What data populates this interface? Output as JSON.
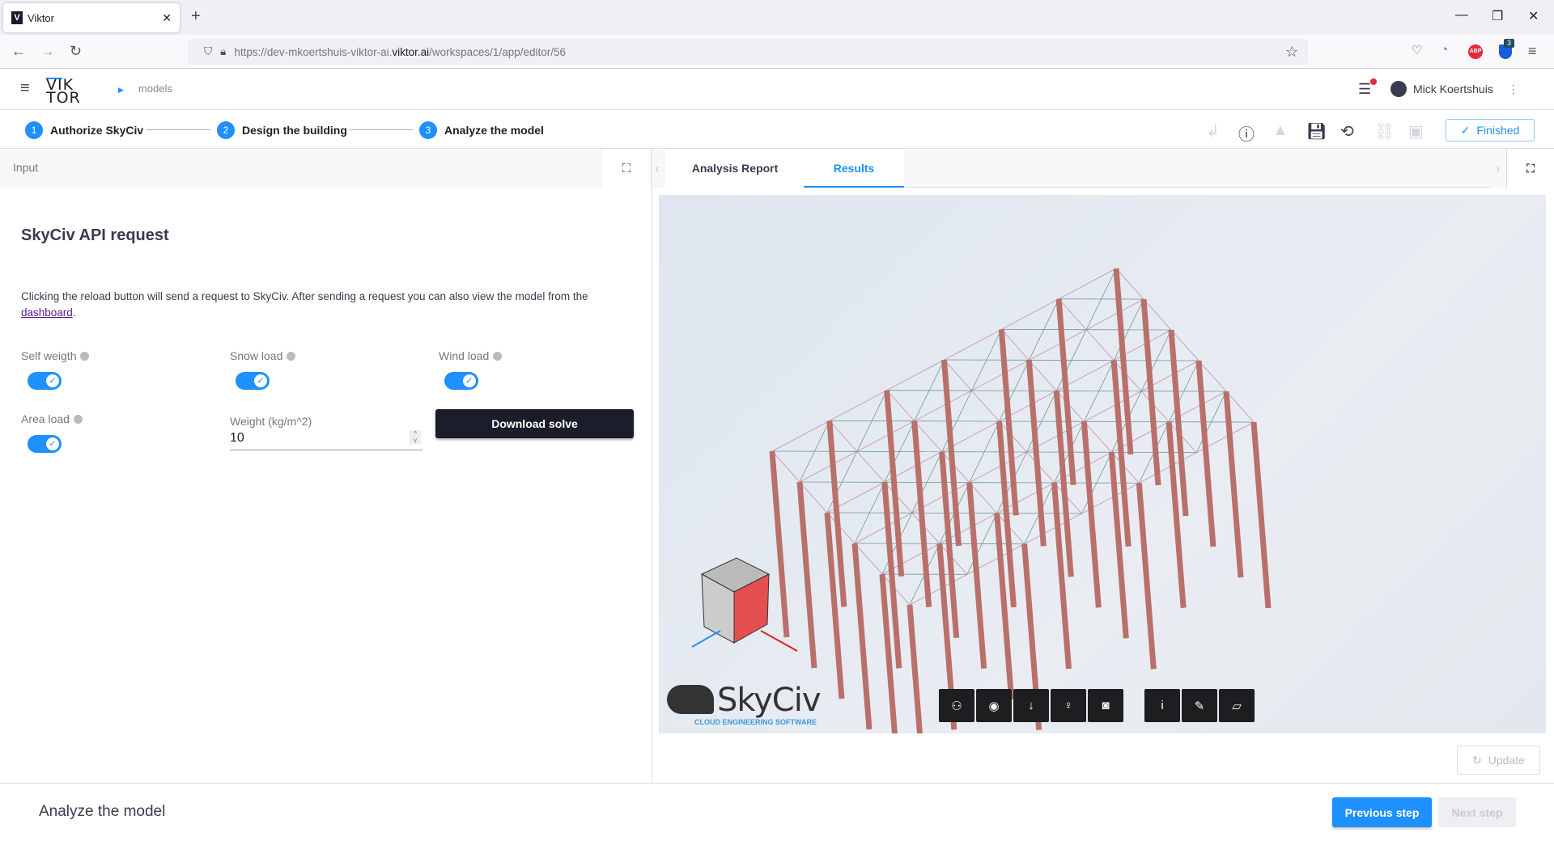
{
  "browser": {
    "tab_title": "Viktor",
    "url_prefix": "https://dev-mkoertshuis-viktor-ai.",
    "url_domain": "viktor.ai",
    "url_path": "/workspaces/1/app/editor/56",
    "bitwarden_badge": "3"
  },
  "header": {
    "logo_line1": "VIK",
    "logo_line2": "TOR",
    "breadcrumb": "models",
    "user_name": "Mick Koertshuis"
  },
  "steps": [
    {
      "number": "1",
      "label": "Authorize SkyCiv"
    },
    {
      "number": "2",
      "label": "Design the building"
    },
    {
      "number": "3",
      "label": "Analyze the model"
    }
  ],
  "toolbar": {
    "finished_label": "Finished"
  },
  "input_panel": {
    "header": "Input",
    "title": "SkyCiv API request",
    "description": "Clicking the reload button will send a request to SkyCiv. After sending a request you can also view the model from the ",
    "link_text": "dashboard",
    "fields": {
      "self_weight": {
        "label": "Self weigth",
        "checked": true
      },
      "snow_load": {
        "label": "Snow load",
        "checked": true
      },
      "wind_load": {
        "label": "Wind load",
        "checked": true
      },
      "area_load": {
        "label": "Area load",
        "checked": true
      },
      "weight": {
        "label": "Weight (kg/m^2)",
        "value": "10"
      }
    },
    "download_label": "Download solve"
  },
  "results_panel": {
    "tabs": [
      {
        "label": "Analysis Report",
        "active": false
      },
      {
        "label": "Results",
        "active": true
      }
    ],
    "skyciv_logo": "SkyCiv",
    "skyciv_tagline": "CLOUD ENGINEERING SOFTWARE",
    "update_label": "Update"
  },
  "footer": {
    "title": "Analyze the model",
    "previous_label": "Previous step",
    "next_label": "Next step"
  },
  "colors": {
    "accent": "#1e90ff",
    "dark_button": "#1c1d2b",
    "column": "#b9706a"
  }
}
